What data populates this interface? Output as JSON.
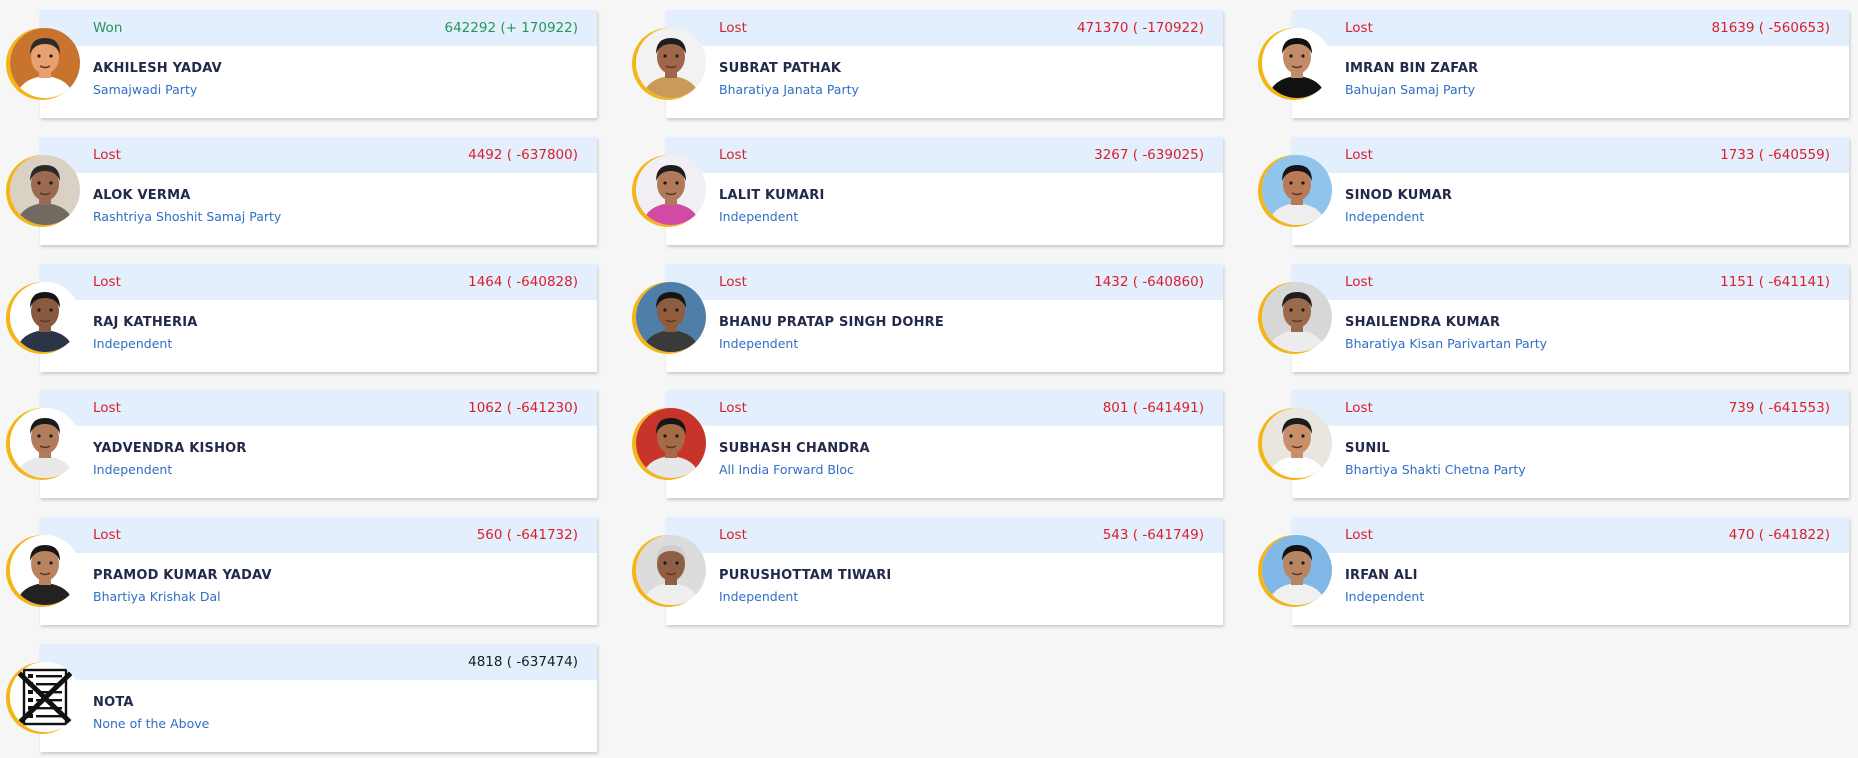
{
  "candidates": [
    {
      "status": "Won",
      "votes": "642292 (+ 170922)",
      "name": "AKHILESH YADAV",
      "party": "Samajwadi Party",
      "photo_bg": "#c8742f",
      "skin": "#e8a070",
      "hair": "#2b2b2b",
      "shirt": "#ffffff"
    },
    {
      "status": "Lost",
      "votes": "471370 ( -170922)",
      "name": "SUBRAT PATHAK",
      "party": "Bharatiya Janata Party",
      "photo_bg": "#f2f2f2",
      "skin": "#a0664a",
      "hair": "#1e1e1e",
      "shirt": "#c99a5a"
    },
    {
      "status": "Lost",
      "votes": "81639 ( -560653)",
      "name": "IMRAN BIN ZAFAR",
      "party": "Bahujan Samaj Party",
      "photo_bg": "#ffffff",
      "skin": "#c28b6a",
      "hair": "#111111",
      "shirt": "#111111"
    },
    {
      "status": "Lost",
      "votes": "4492 ( -637800)",
      "name": "ALOK VERMA",
      "party": "Rashtriya Shoshit Samaj Party",
      "photo_bg": "#d9d2c4",
      "skin": "#9c6a50",
      "hair": "#2a2a2a",
      "shirt": "#6f6a62"
    },
    {
      "status": "Lost",
      "votes": "3267 ( -639025)",
      "name": "LALIT KUMARI",
      "party": "Independent",
      "photo_bg": "#f2eef6",
      "skin": "#b07a5a",
      "hair": "#1b1b1b",
      "shirt": "#d34aa5"
    },
    {
      "status": "Lost",
      "votes": "1733 ( -640559)",
      "name": "SINOD KUMAR",
      "party": "Independent",
      "photo_bg": "#8fc4ec",
      "skin": "#b97a58",
      "hair": "#151515",
      "shirt": "#eeeeee"
    },
    {
      "status": "Lost",
      "votes": "1464 ( -640828)",
      "name": "RAJ KATHERIA",
      "party": "Independent",
      "photo_bg": "#ffffff",
      "skin": "#8a5a40",
      "hair": "#151515",
      "shirt": "#2c3548"
    },
    {
      "status": "Lost",
      "votes": "1432 ( -640860)",
      "name": "BHANU PRATAP SINGH DOHRE",
      "party": "Independent",
      "photo_bg": "#4f7fa8",
      "skin": "#8f5c3e",
      "hair": "#151515",
      "shirt": "#3a3a3a"
    },
    {
      "status": "Lost",
      "votes": "1151 ( -641141)",
      "name": "SHAILENDRA KUMAR",
      "party": "Bharatiya Kisan Parivartan Party",
      "photo_bg": "#d7d7d7",
      "skin": "#9a6a4c",
      "hair": "#1e1e1e",
      "shirt": "#ececec"
    },
    {
      "status": "Lost",
      "votes": "1062 ( -641230)",
      "name": "YADVENDRA KISHOR",
      "party": "Independent",
      "photo_bg": "#ffffff",
      "skin": "#b17c5c",
      "hair": "#1a1a1a",
      "shirt": "#e9e9e9"
    },
    {
      "status": "Lost",
      "votes": "801 ( -641491)",
      "name": "SUBHASH CHANDRA",
      "party": "All India Forward Bloc",
      "photo_bg": "#c7352a",
      "skin": "#a56a48",
      "hair": "#161616",
      "shirt": "#e7e7e7"
    },
    {
      "status": "Lost",
      "votes": "739 ( -641553)",
      "name": "SUNIL",
      "party": "Bhartiya Shakti Chetna Party",
      "photo_bg": "#e9e6e0",
      "skin": "#c98f6b",
      "hair": "#1b1b1b",
      "shirt": "#ffffff"
    },
    {
      "status": "Lost",
      "votes": "560 ( -641732)",
      "name": "PRAMOD KUMAR YADAV",
      "party": "Bhartiya Krishak Dal",
      "photo_bg": "#ffffff",
      "skin": "#b9835f",
      "hair": "#171717",
      "shirt": "#222222"
    },
    {
      "status": "Lost",
      "votes": "543 ( -641749)",
      "name": "PURUSHOTTAM TIWARI",
      "party": "Independent",
      "photo_bg": "#dcdcdc",
      "skin": "#8e5f44",
      "hair": "#cfcfcf",
      "shirt": "#efefef"
    },
    {
      "status": "Lost",
      "votes": "470 ( -641822)",
      "name": "IRFAN ALI",
      "party": "Independent",
      "photo_bg": "#7fb8e6",
      "skin": "#b88563",
      "hair": "#121212",
      "shirt": "#f0f0f0"
    },
    {
      "status": "",
      "votes": "4818 ( -637474)",
      "name": "NOTA",
      "party": "None of the Above",
      "photo_bg": "#ffffff",
      "skin": "",
      "hair": "",
      "shirt": "",
      "icon": "nota-ballot-cross-icon"
    }
  ],
  "colors": {
    "won": "#26955a",
    "lost": "#d91f2b",
    "name": "#23294a",
    "party": "#2f6fc4",
    "header_band": "#e3effd",
    "ring": "#f4b517"
  }
}
